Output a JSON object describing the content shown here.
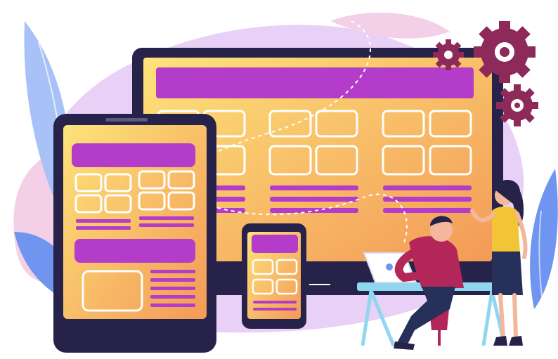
{
  "illustration": {
    "subject": "responsive-web-design",
    "palette": {
      "background": "#ffffff",
      "blob_lavender": "#e4c8f4",
      "blob_pink": "#f4cfe8",
      "leaf_blue": "#6f95f0",
      "leaf_light": "#a8c2f7",
      "device_frame": "#26224a",
      "screen_yellow": "#fde37a",
      "screen_orange": "#f39a57",
      "bar_purple": "#b33cc9",
      "card_outline": "#ffffff",
      "gear_maroon": "#8e2a5a",
      "man_shirt": "#b3265a",
      "pants_navy": "#27305a",
      "woman_top": "#f2c436",
      "skin": "#f3b79c",
      "desk_blue": "#8fd6f0"
    },
    "icons": [
      "gear-icon",
      "gear-icon",
      "gear-icon",
      "laptop-icon"
    ]
  }
}
